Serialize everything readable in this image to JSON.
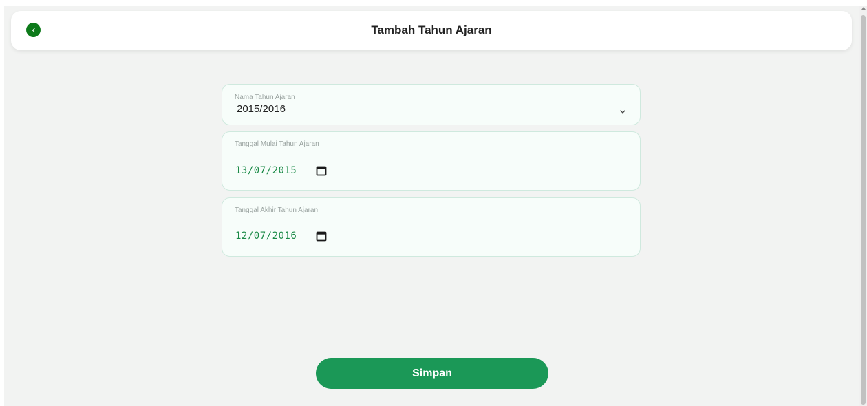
{
  "header": {
    "title": "Tambah Tahun Ajaran",
    "back_icon": "chevron-left-icon"
  },
  "form": {
    "academic_year": {
      "label": "Nama Tahun Ajaran",
      "value": "2015/2016",
      "icon": "chevron-down-icon"
    },
    "start_date": {
      "label": "Tanggal Mulai Tahun Ajaran",
      "value": "13/07/2015",
      "icon": "calendar-icon"
    },
    "end_date": {
      "label": "Tanggal Akhir Tahun Ajaran",
      "value": "12/07/2016",
      "icon": "calendar-icon"
    }
  },
  "actions": {
    "save_label": "Simpan"
  },
  "colors": {
    "accent": "#1b9857",
    "back_button": "#0d7a1a",
    "date_text": "#1b8a47",
    "background": "#f2f3f2"
  }
}
